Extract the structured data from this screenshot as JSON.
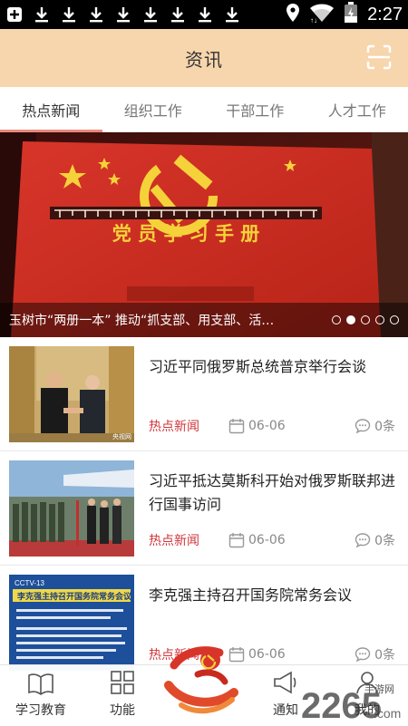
{
  "statusbar": {
    "time": "2:27",
    "icons": [
      "app-notification-icon",
      "download-icon",
      "download-icon",
      "download-icon",
      "download-icon",
      "download-icon",
      "download-icon",
      "download-icon",
      "download-icon"
    ],
    "right_icons": [
      "location-icon",
      "wifi-icon",
      "battery-charging-icon"
    ],
    "battery_level": "2"
  },
  "header": {
    "title": "资讯",
    "scan_icon": "scan-icon"
  },
  "tabs": [
    {
      "label": "热点新闻",
      "active": true
    },
    {
      "label": "组织工作",
      "active": false
    },
    {
      "label": "干部工作",
      "active": false
    },
    {
      "label": "人才工作",
      "active": false
    }
  ],
  "banner": {
    "book_title": "党 员 学 习 手 册",
    "caption": "玉树市“两册一本” 推动“抓支部、用支部、活…",
    "dots_total": 5,
    "dots_active": 2
  },
  "news": [
    {
      "title": "习近平同俄罗斯总统普京举行会谈",
      "category": "热点新闻",
      "date": "06-06",
      "comments": "0条"
    },
    {
      "title": "习近平抵达莫斯科开始对俄罗斯联邦进行国事访问",
      "category": "热点新闻",
      "date": "06-06",
      "comments": "0条"
    },
    {
      "title": "李克强主持召开国务院常务会议",
      "category": "热点新闻",
      "date": "06-06",
      "comments": "0条"
    }
  ],
  "thumb_texts": {
    "t1_badge": "央视网",
    "t3_logo": "CCTV-13",
    "t3_headline": "李克强主持召开国务院常务会议"
  },
  "bottomnav": [
    {
      "label": "学习教育",
      "icon": "book-icon"
    },
    {
      "label": "功能",
      "icon": "grid-icon"
    },
    {
      "label": "",
      "icon": "party-emblem-logo"
    },
    {
      "label": "通知",
      "icon": "megaphone-icon"
    },
    {
      "label": "我的",
      "icon": "user-icon"
    }
  ],
  "watermark": {
    "brand": "2265",
    "suffix": ".com",
    "sub": "手游网"
  },
  "colors": {
    "header_bg": "#f7d6ad",
    "tab_indicator": "#e8897d",
    "category_red": "#d0363b",
    "banner_red": "#c8281f"
  }
}
